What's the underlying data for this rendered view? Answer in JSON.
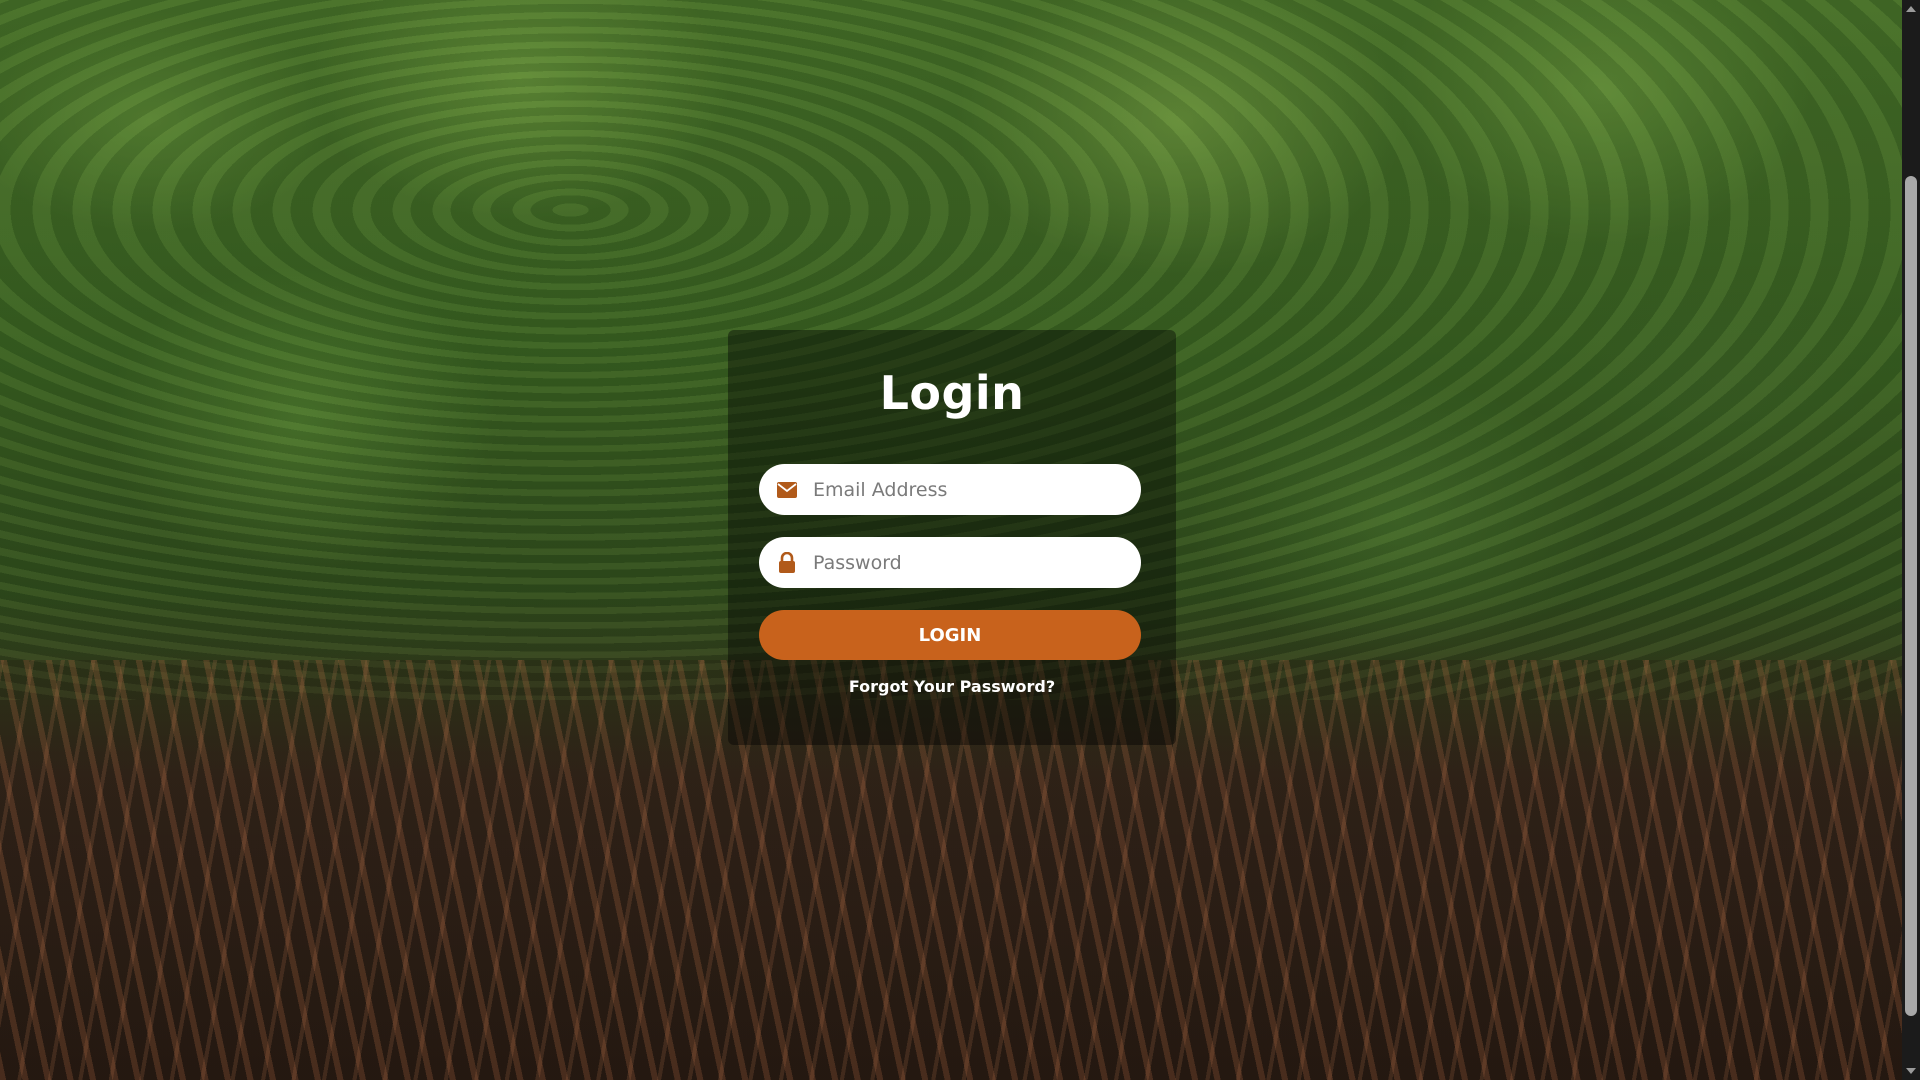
{
  "login": {
    "title": "Login",
    "email_placeholder": "Email Address",
    "password_placeholder": "Password",
    "button_label": "LOGIN",
    "forgot_link": "Forgot Your Password?"
  },
  "icons": {
    "email": "envelope-icon",
    "password": "lock-icon"
  },
  "colors": {
    "accent": "#c8621c",
    "panel_overlay": "rgba(0,0,0,0.40)",
    "field_background": "#ffffff",
    "text_light": "#ffffff"
  },
  "background": {
    "description": "mangrove-forest-photo"
  }
}
